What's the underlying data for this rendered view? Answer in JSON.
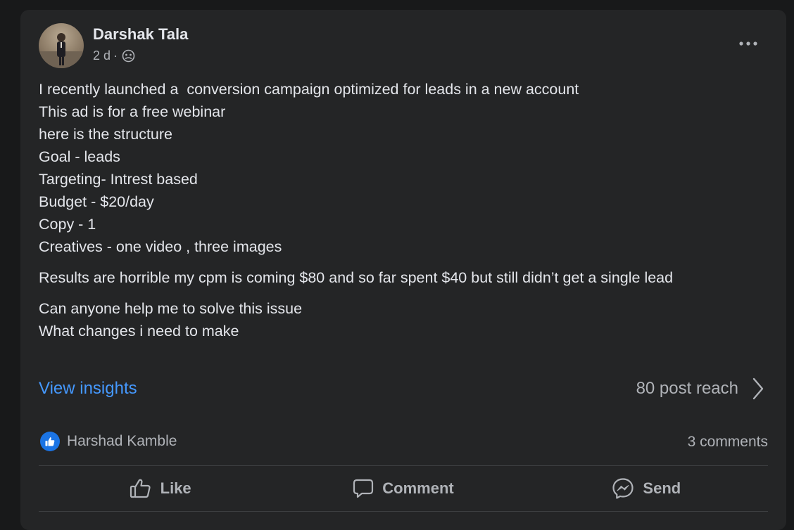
{
  "post": {
    "author": "Darshak Tala",
    "time": "2 d",
    "separator": "·",
    "privacy_icon": "group-globe-icon",
    "more_icon": "more-horizontal-icon",
    "paragraphs": [
      [
        "I recently launched a  conversion campaign optimized for leads in a new account",
        "This ad is for a free webinar",
        "here is the structure",
        "Goal - leads",
        "Targeting- Intrest based",
        "Budget - $20/day",
        "Copy - 1",
        "Creatives - one video , three images"
      ],
      [
        "Results are horrible my cpm is coming $80 and so far spent $40 but still didn’t get a single lead"
      ],
      [
        "Can anyone help me to solve this issue",
        "What changes i need to make"
      ]
    ]
  },
  "insights": {
    "link_label": "View insights",
    "reach_label": "80 post reach"
  },
  "reactions": {
    "icon": "thumbs-up-badge-icon",
    "name": "Harshad Kamble",
    "comments_count": "3 comments"
  },
  "actions": {
    "like": "Like",
    "comment": "Comment",
    "send": "Send"
  },
  "colors": {
    "background": "#18191a",
    "card": "#242526",
    "link": "#4599ff",
    "secondary_text": "#b0b3b8",
    "like_badge": "#1b74e4"
  }
}
